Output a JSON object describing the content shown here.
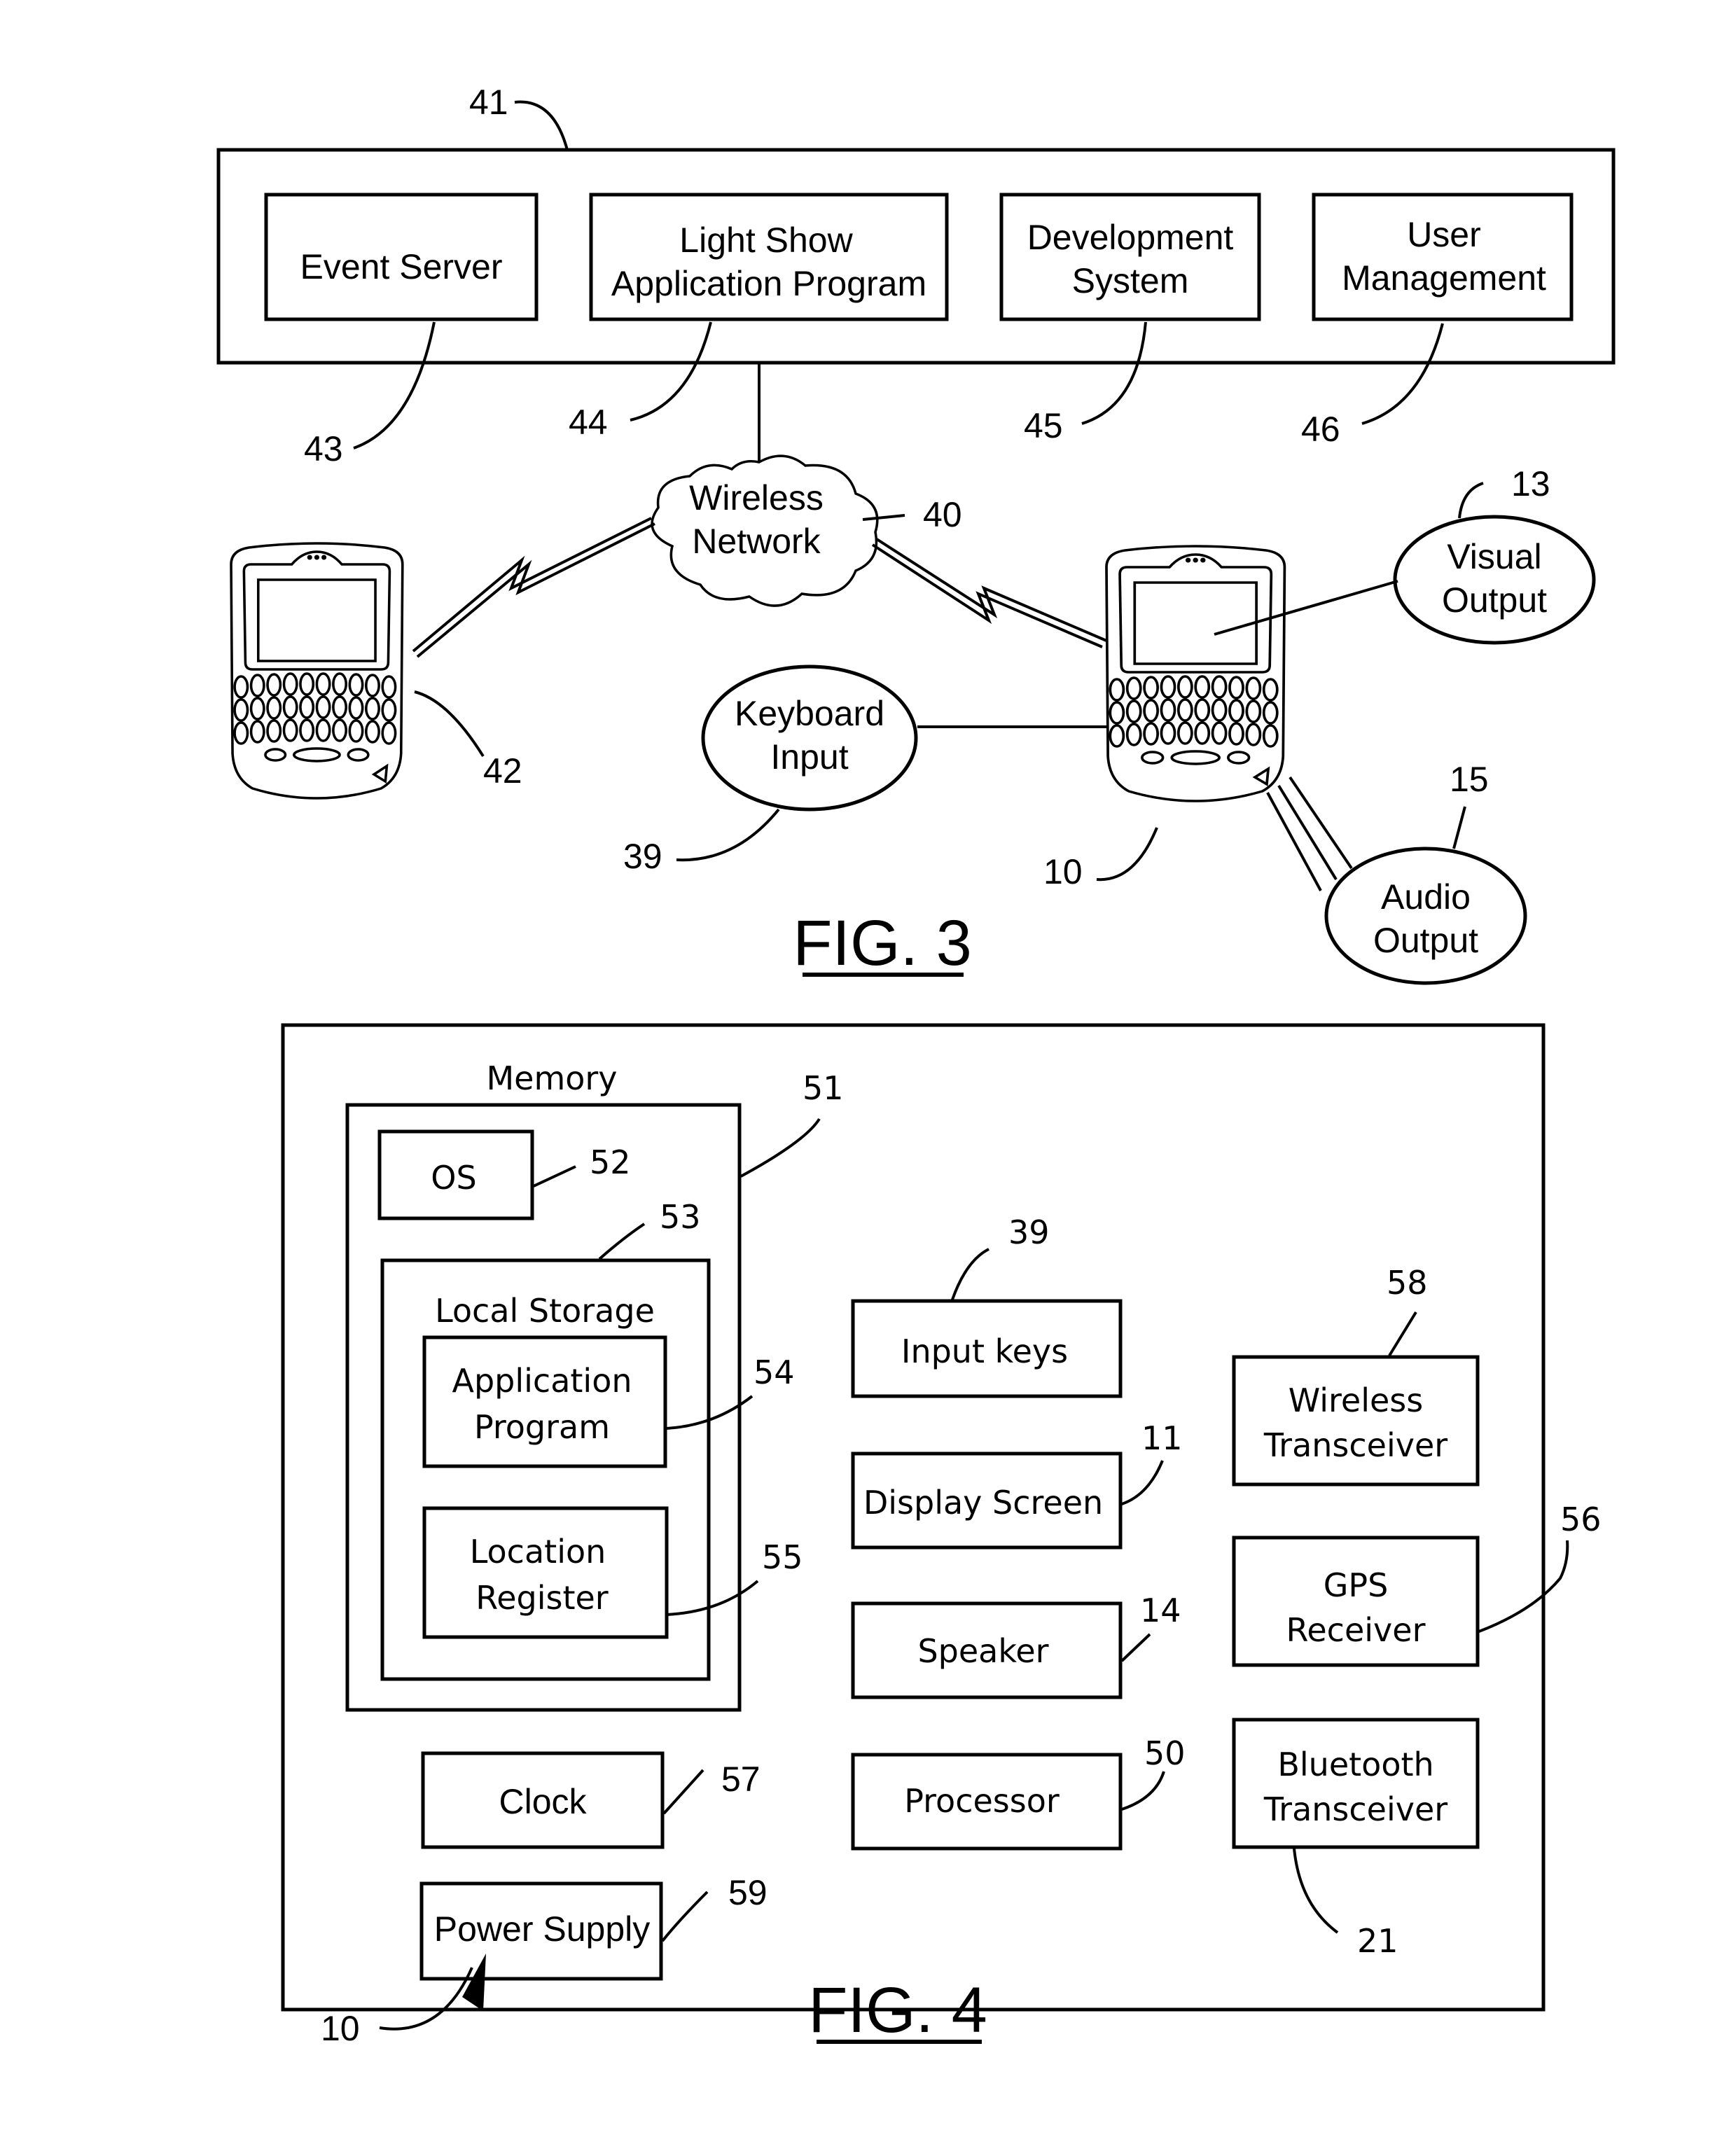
{
  "fig3": {
    "title": "FIG. 3",
    "server_group_ref": "41",
    "server_boxes": [
      {
        "label_lines": [
          "Event Server"
        ],
        "ref": "43"
      },
      {
        "label_lines": [
          "Light Show",
          "Application Program"
        ],
        "ref": "44"
      },
      {
        "label_lines": [
          "Development",
          "System"
        ],
        "ref": "45"
      },
      {
        "label_lines": [
          "User",
          "Management"
        ],
        "ref": "46"
      }
    ],
    "network": {
      "label_lines": [
        "Wireless",
        "Network"
      ],
      "ref": "40"
    },
    "left_device_ref": "42",
    "right_device_ref": "10",
    "keyboard_input": {
      "label_lines": [
        "Keyboard",
        "Input"
      ],
      "ref": "39"
    },
    "visual_output": {
      "label_lines": [
        "Visual",
        "Output"
      ],
      "ref": "13"
    },
    "audio_output": {
      "label_lines": [
        "Audio",
        "Output"
      ],
      "ref": "15"
    }
  },
  "fig4": {
    "title": "FIG. 4",
    "device_ref": "10",
    "memory": {
      "label": "Memory",
      "ref": "51"
    },
    "os": {
      "label": "OS",
      "ref": "52"
    },
    "local_storage": {
      "label": "Local Storage",
      "ref": "53"
    },
    "application_program": {
      "label_lines": [
        "Application",
        "Program"
      ],
      "ref": "54"
    },
    "location_register": {
      "label_lines": [
        "Location",
        "Register"
      ],
      "ref": "55"
    },
    "clock": {
      "label": "Clock",
      "ref": "57"
    },
    "power_supply": {
      "label": "Power Supply",
      "ref": "59"
    },
    "input_keys": {
      "label": "Input keys",
      "ref": "39"
    },
    "display_screen": {
      "label": "Display Screen",
      "ref": "11"
    },
    "speaker": {
      "label": "Speaker",
      "ref": "14"
    },
    "processor": {
      "label": "Processor",
      "ref": "50"
    },
    "wireless_transceiver": {
      "label_lines": [
        "Wireless",
        "Transceiver"
      ],
      "ref": "58"
    },
    "gps_receiver": {
      "label_lines": [
        "GPS",
        "Receiver"
      ],
      "ref": "56"
    },
    "bluetooth_transceiver": {
      "label_lines": [
        "Bluetooth",
        "Transceiver"
      ],
      "ref": "21"
    }
  }
}
